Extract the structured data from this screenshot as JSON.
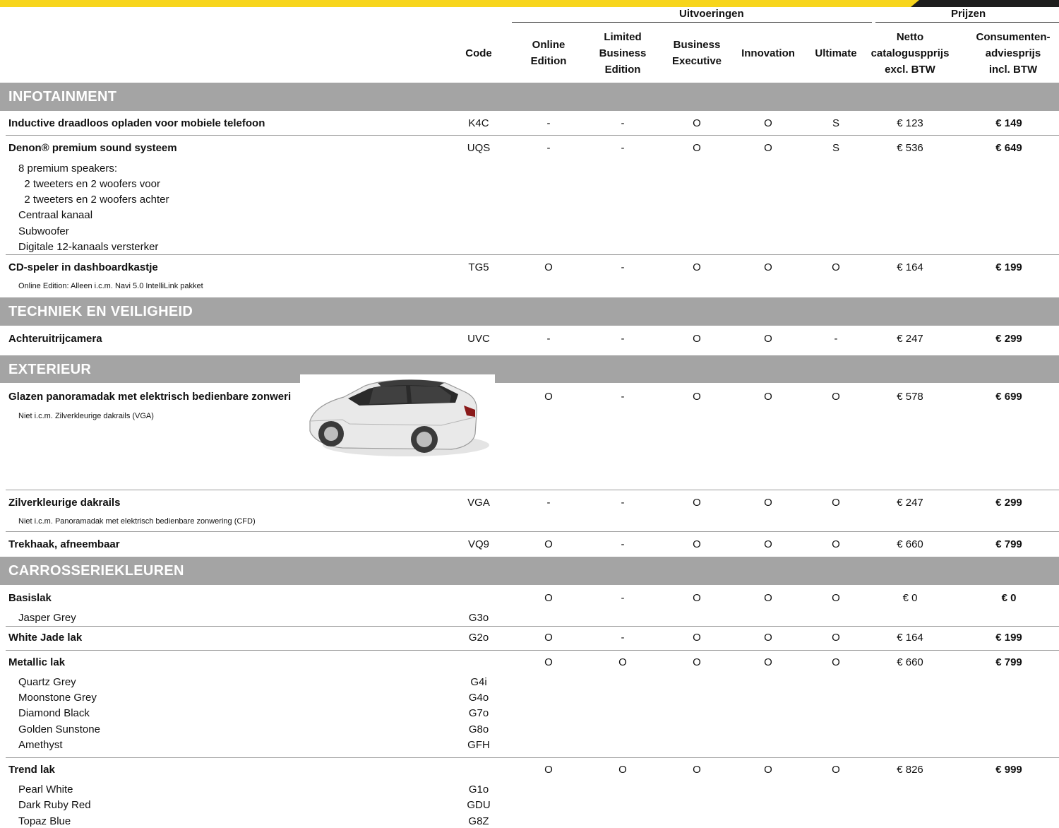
{
  "header": {
    "group_versions": "Uitvoeringen",
    "group_prices": "Prijzen",
    "code": "Code",
    "versions": [
      [
        "Online",
        "Edition"
      ],
      [
        "Limited",
        "Business",
        "Edition"
      ],
      [
        "Business",
        "Executive"
      ],
      [
        "Innovation"
      ],
      [
        "Ultimate"
      ]
    ],
    "net_price": [
      "Netto",
      "cataloguspprijs",
      "excl. BTW"
    ],
    "consumer_price": [
      "Consumenten-",
      "adviesprijs",
      "incl. BTW"
    ]
  },
  "sections": {
    "infotainment": "INFOTAINMENT",
    "techniek": "TECHNIEK EN VEILIGHEID",
    "exterieur": "EXTERIEUR",
    "kleuren": "CARROSSERIEKLEUREN"
  },
  "rows": {
    "inductive": {
      "name": "Inductive draadloos opladen voor mobiele telefoon",
      "code": "K4C",
      "v": [
        "-",
        "-",
        "O",
        "O",
        "S"
      ],
      "net": "€ 123",
      "price": "€ 149"
    },
    "denon": {
      "name": "Denon® premium sound systeem",
      "code": "UQS",
      "v": [
        "-",
        "-",
        "O",
        "O",
        "S"
      ],
      "net": "€ 536",
      "price": "€ 649",
      "details": [
        "8 premium speakers:",
        "  2 tweeters en 2 woofers voor",
        "  2 tweeters en 2 woofers achter",
        "Centraal kanaal",
        "Subwoofer",
        "Digitale 12-kanaals versterker"
      ]
    },
    "cd": {
      "name": "CD-speler in dashboardkastje",
      "code": "TG5",
      "v": [
        "O",
        "-",
        "O",
        "O",
        "O"
      ],
      "net": "€ 164",
      "price": "€ 199",
      "note": "Online Edition: Alleen i.c.m. Navi 5.0 IntelliLink pakket"
    },
    "camera": {
      "name": "Achteruitrijcamera",
      "code": "UVC",
      "v": [
        "-",
        "-",
        "O",
        "O",
        "-"
      ],
      "net": "€ 247",
      "price": "€ 299"
    },
    "panorama": {
      "name": "Glazen panoramadak met elektrisch bedienbare zonweri",
      "v": [
        "O",
        "-",
        "O",
        "O",
        "O"
      ],
      "net": "€ 578",
      "price": "€ 699",
      "note": "Niet i.c.m. Zilverkleurige dakrails (VGA)"
    },
    "dakrails": {
      "name": "Zilverkleurige dakrails",
      "code": "VGA",
      "v": [
        "-",
        "-",
        "O",
        "O",
        "O"
      ],
      "net": "€ 247",
      "price": "€ 299",
      "note": "Niet i.c.m. Panoramadak met elektrisch bedienbare zonwering (CFD)"
    },
    "trekhaak": {
      "name": "Trekhaak, afneembaar",
      "code": "VQ9",
      "v": [
        "O",
        "-",
        "O",
        "O",
        "O"
      ],
      "net": "€ 660",
      "price": "€ 799"
    },
    "basislak": {
      "name": "Basislak",
      "v": [
        "O",
        "-",
        "O",
        "O",
        "O"
      ],
      "net": "€ 0",
      "price": "€ 0",
      "colors": [
        {
          "name": "Jasper Grey",
          "code": "G3o"
        }
      ]
    },
    "whitejade": {
      "name": "White Jade lak",
      "code": "G2o",
      "v": [
        "O",
        "-",
        "O",
        "O",
        "O"
      ],
      "net": "€ 164",
      "price": "€ 199"
    },
    "metallic": {
      "name": "Metallic lak",
      "v": [
        "O",
        "O",
        "O",
        "O",
        "O"
      ],
      "net": "€ 660",
      "price": "€ 799",
      "colors": [
        {
          "name": "Quartz Grey",
          "code": "G4i"
        },
        {
          "name": "Moonstone Grey",
          "code": "G4o"
        },
        {
          "name": "Diamond Black",
          "code": "G7o"
        },
        {
          "name": "Golden Sunstone",
          "code": "G8o"
        },
        {
          "name": "Amethyst",
          "code": "GFH"
        }
      ]
    },
    "trend": {
      "name": "Trend lak",
      "v": [
        "O",
        "O",
        "O",
        "O",
        "O"
      ],
      "net": "€ 826",
      "price": "€ 999",
      "colors": [
        {
          "name": "Pearl White",
          "code": "G1o"
        },
        {
          "name": "Dark Ruby Red",
          "code": "GDU"
        },
        {
          "name": "Topaz Blue",
          "code": "G8Z"
        }
      ]
    }
  },
  "colors": {
    "accent_yellow": "#f7d51d",
    "section_band": "#a4a4a4"
  }
}
